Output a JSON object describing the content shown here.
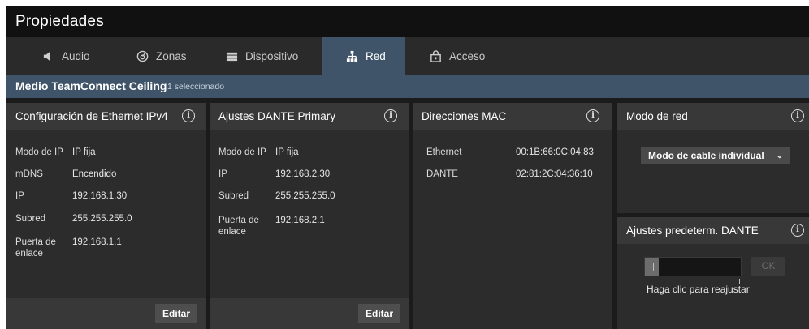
{
  "window": {
    "title": "Propiedades"
  },
  "tabs": [
    {
      "label": "Audio",
      "icon": "speaker-icon",
      "active": false
    },
    {
      "label": "Zonas",
      "icon": "zones-icon",
      "active": false
    },
    {
      "label": "Dispositivo",
      "icon": "device-icon",
      "active": false
    },
    {
      "label": "Red",
      "icon": "network-icon",
      "active": true
    },
    {
      "label": "Acceso",
      "icon": "lock-icon",
      "active": false
    }
  ],
  "device": {
    "name": "Medio TeamConnect Ceiling",
    "selection": "1 seleccionado"
  },
  "colors": {
    "accent": "#3f5468",
    "background": "#1b1b1b",
    "panel": "#2c2c2c",
    "panel_header": "#383838"
  },
  "ipv4": {
    "title": "Configuración de Ethernet IPv4",
    "rows": [
      {
        "key": "Modo de IP",
        "value": "IP fija"
      },
      {
        "key": "mDNS",
        "value": "Encendido"
      },
      {
        "key": "IP",
        "value": "192.168.1.30"
      },
      {
        "key": "Subred",
        "value": "255.255.255.0"
      },
      {
        "key": "Puerta de enlace",
        "value": "192.168.1.1"
      }
    ],
    "edit_label": "Editar"
  },
  "dante": {
    "title": "Ajustes DANTE Primary",
    "rows": [
      {
        "key": "Modo de IP",
        "value": "IP fija"
      },
      {
        "key": "IP",
        "value": "192.168.2.30"
      },
      {
        "key": "Subred",
        "value": "255.255.255.0"
      },
      {
        "key": "Puerta de enlace",
        "value": "192.168.2.1"
      }
    ],
    "edit_label": "Editar"
  },
  "mac": {
    "title": "Direcciones MAC",
    "rows": [
      {
        "key": "Ethernet",
        "value": "00:1B:66:0C:04:83"
      },
      {
        "key": "DANTE",
        "value": "02:81:2C:04:36:10"
      }
    ]
  },
  "network_mode": {
    "title": "Modo de red",
    "selected": "Modo de cable individual"
  },
  "dante_reset": {
    "title": "Ajustes predeterm. DANTE",
    "ok_label": "OK",
    "hint": "Haga clic para reajustar",
    "progress": 0.14
  }
}
